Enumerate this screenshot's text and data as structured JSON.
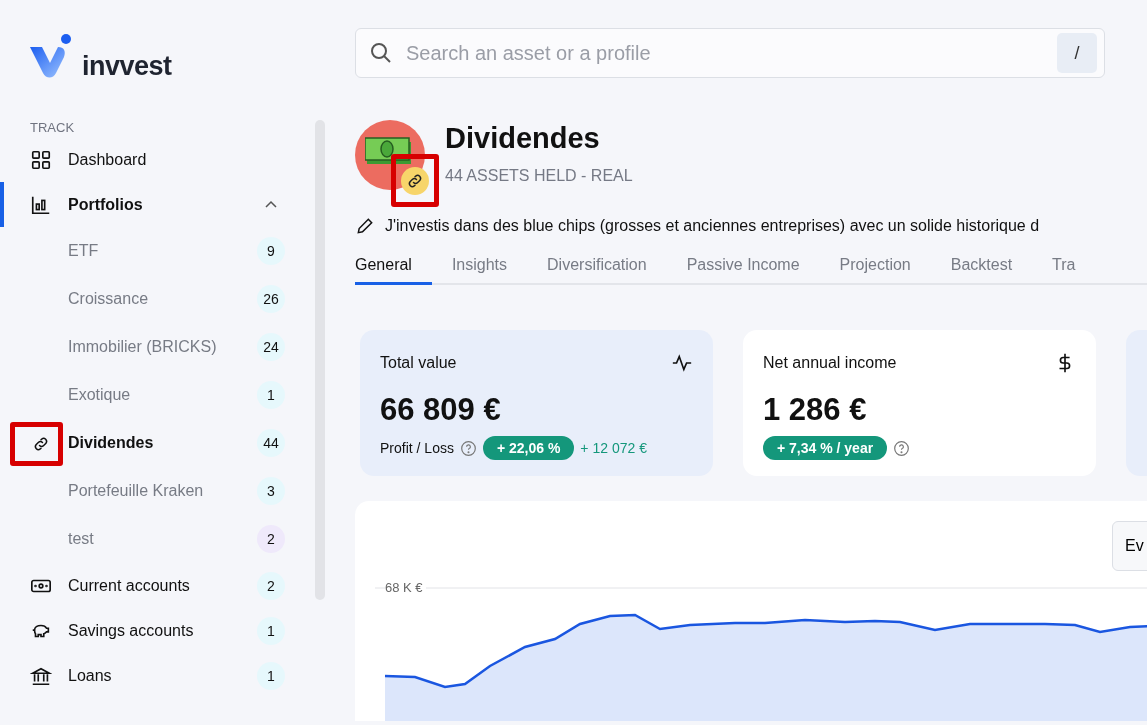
{
  "logo": {
    "text": "invvest"
  },
  "sidebar": {
    "section": "TRACK",
    "items": [
      {
        "label": "Dashboard",
        "selected": false
      },
      {
        "label": "Portfolios",
        "selected": true,
        "expanded": true,
        "children": [
          {
            "label": "ETF",
            "count": "9",
            "selected": false,
            "color": "#e6f8fc"
          },
          {
            "label": "Croissance",
            "count": "26",
            "selected": false,
            "color": "#e6f8fc"
          },
          {
            "label": "Immobilier (BRICKS)",
            "count": "24",
            "selected": false,
            "color": "#e6f8fc"
          },
          {
            "label": "Exotique",
            "count": "1",
            "selected": false,
            "color": "#e6f8fc"
          },
          {
            "label": "Dividendes",
            "count": "44",
            "selected": true,
            "linked": true,
            "color": "#e6f8fc"
          },
          {
            "label": "Portefeuille Kraken",
            "count": "3",
            "selected": false,
            "color": "#e6f8fc"
          },
          {
            "label": "test",
            "count": "2",
            "selected": false,
            "color": "#efe9fb"
          }
        ]
      },
      {
        "label": "Current accounts",
        "count": "2",
        "selected": false
      },
      {
        "label": "Savings accounts",
        "count": "1",
        "selected": false
      },
      {
        "label": "Loans",
        "count": "1",
        "selected": false
      }
    ]
  },
  "search": {
    "placeholder": "Search an asset or a profile",
    "shortcut": "/"
  },
  "profile": {
    "title": "Dividendes",
    "subtitle": "44 ASSETS HELD - REAL",
    "linked": true,
    "description": "J'investis dans des blue chips (grosses et anciennes entreprises) avec un solide historique d"
  },
  "tabs": [
    {
      "label": "General",
      "selected": true
    },
    {
      "label": "Insights",
      "selected": false
    },
    {
      "label": "Diversification",
      "selected": false
    },
    {
      "label": "Passive Income",
      "selected": false
    },
    {
      "label": "Projection",
      "selected": false
    },
    {
      "label": "Backtest",
      "selected": false
    },
    {
      "label": "Tra",
      "selected": false
    }
  ],
  "cards": [
    {
      "kind": "total",
      "title": "Total value",
      "value": "66 809 €",
      "label": "Profit / Loss",
      "pill": "+ 22,06 %",
      "delta": "+ 12 072 €"
    },
    {
      "kind": "income",
      "title": "Net annual income",
      "value": "1 286 €",
      "pill": "+ 7,34 % / year"
    }
  ],
  "chart": {
    "button": "Ev",
    "tick": "68 K €"
  }
}
